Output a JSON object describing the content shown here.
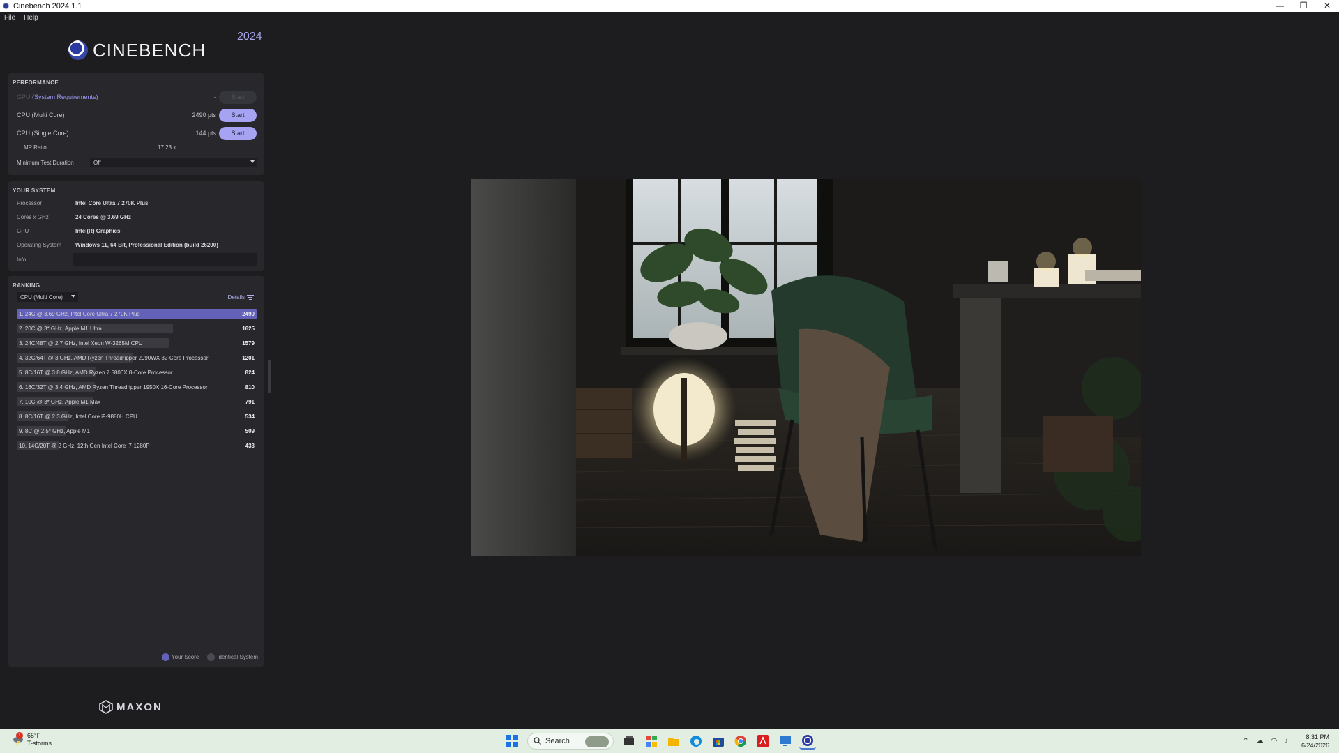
{
  "window": {
    "title": "Cinebench 2024.1.1",
    "controls": [
      "—",
      "❐",
      "✕"
    ]
  },
  "menu": [
    "File",
    "Help"
  ],
  "brand": {
    "logo_text": "CINEBENCH",
    "year": "2024"
  },
  "performance": {
    "title": "PERFORMANCE",
    "gpu_label": "GPU",
    "gpu_link": "(System Requirements)",
    "gpu_value": "-",
    "multi_label": "CPU (Multi Core)",
    "multi_value": "2490 pts",
    "single_label": "CPU (Single Core)",
    "single_value": "144 pts",
    "ratio_label": "MP Ratio",
    "ratio_value": "17.23 x",
    "duration_label": "Minimum Test Duration",
    "duration_value": "Off",
    "start_label": "Start"
  },
  "system": {
    "title": "YOUR SYSTEM",
    "rows": [
      {
        "label": "Processor",
        "value": "Intel Core Ultra 7 270K Plus"
      },
      {
        "label": "Cores x GHz",
        "value": "24 Cores @ 3.69 GHz"
      },
      {
        "label": "GPU",
        "value": "Intel(R) Graphics"
      },
      {
        "label": "Operating System",
        "value": "Windows 11, 64 Bit, Professional Edition (build 26200)"
      }
    ],
    "info_label": "Info"
  },
  "ranking": {
    "title": "RANKING",
    "selected": "CPU (Multi Core)",
    "details_label": "Details",
    "max_score": 2490,
    "rows": [
      {
        "name": "1. 24C @ 3.69 GHz, Intel Core Ultra 7 270K Plus",
        "score": "2490",
        "value": 2490
      },
      {
        "name": "2. 20C @ 3* GHz, Apple M1 Ultra",
        "score": "1625",
        "value": 1625
      },
      {
        "name": "3. 24C/48T @ 2.7 GHz, Intel Xeon W-3265M CPU",
        "score": "1579",
        "value": 1579
      },
      {
        "name": "4. 32C/64T @ 3 GHz, AMD Ryzen Threadripper 2990WX 32-Core Processor",
        "score": "1201",
        "value": 1201
      },
      {
        "name": "5. 8C/16T @ 3.8 GHz, AMD Ryzen 7 5800X 8-Core Processor",
        "score": "824",
        "value": 824
      },
      {
        "name": "6. 16C/32T @ 3.4 GHz, AMD Ryzen Threadripper 1950X 16-Core Processor",
        "score": "810",
        "value": 810
      },
      {
        "name": "7. 10C @ 3* GHz, Apple M1 Max",
        "score": "791",
        "value": 791
      },
      {
        "name": "8. 8C/16T @ 2.3 GHz, Intel Core i9-9880H CPU",
        "score": "534",
        "value": 534
      },
      {
        "name": "9. 8C @ 2.5* GHz, Apple M1",
        "score": "509",
        "value": 509
      },
      {
        "name": "10. 14C/20T @ 2 GHz, 12th Gen Intel Core i7-1280P",
        "score": "433",
        "value": 433
      }
    ],
    "legend": {
      "your_score": "Your Score",
      "identical": "Identical System"
    },
    "colors": {
      "your_score": "#6461b8",
      "identical": "#4a4a52"
    }
  },
  "footer": {
    "maxon": "MAXON"
  },
  "taskbar": {
    "weather_temp": "65°F",
    "weather_desc": "T-storms",
    "weather_badge": "1",
    "search_label": "Search",
    "time": "8:31 PM",
    "date": "6/24/2026"
  },
  "colors": {
    "accent": "#a6a3f2",
    "panel": "#27272c",
    "background": "#1d1d20"
  }
}
